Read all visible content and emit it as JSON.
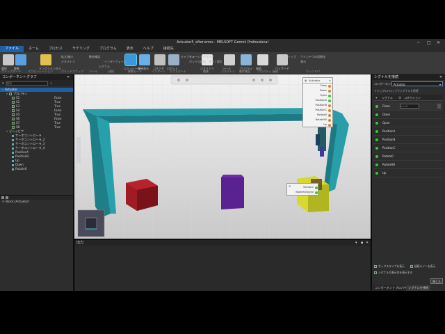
{
  "window": {
    "title": "Actuator5_after.emrx - MELSOFT Gemini Professional"
  },
  "menu": {
    "items": [
      "ファイル",
      "ホーム",
      "プロセス",
      "モデリング",
      "プログラム",
      "表示",
      "ヘルプ",
      "接続先"
    ],
    "active_index": 0
  },
  "ribbon": {
    "buttons": [
      {
        "label": "選択",
        "color": "#c8c8c8"
      },
      {
        "label": "移動",
        "color": "#5aa0e0"
      },
      {
        "label": "インクリメンタル",
        "color": "#e0c050"
      },
      {
        "label": "エミュレーター",
        "color": "#3a9ad9"
      },
      {
        "label": "接続表示",
        "color": "#6ab0e8"
      },
      {
        "label": "コネクタ",
        "color": "#c0c0c0"
      },
      {
        "label": "ロボット",
        "color": "#9ab0c8"
      },
      {
        "label": "ジオメトリ",
        "color": "#e6e6e6"
      },
      {
        "label": "ツール",
        "color": "#d0d0d0"
      },
      {
        "label": "プロパティ",
        "color": "#8ab4d8"
      },
      {
        "label": "接続",
        "color": "#d8d8d8"
      },
      {
        "label": "ウィザード",
        "color": "#c8c8c8"
      }
    ],
    "small": [
      "拡大/縮小",
      "ジオメトリ",
      "動作確認",
      "インターフェース",
      "シグナル",
      "キャプチャ",
      "ミュージックマルチ",
      "ボックス追加",
      "表示 / 隠れ",
      "ストップ",
      "ウインドウの初期化",
      "表示"
    ],
    "groups": [
      "クリップボード",
      "マニピュレーション",
      "グリッドスナップ",
      "ツール",
      "接続",
      "移動モード",
      "インポート",
      "エクスポート",
      "編集",
      "ジオメトリ",
      "動作確認",
      "プロパティ",
      "接続",
      "ウィンドウ"
    ]
  },
  "left_panel": {
    "title": "コンポーネントグラフ",
    "search_placeholder": "検索",
    "tree": [
      {
        "label": "Actuator",
        "value": "",
        "indent": 0,
        "selected": true,
        "check": false
      },
      {
        "label": "プロパティ",
        "value": "",
        "indent": 1,
        "selected": false,
        "check": true
      },
      {
        "label": "S1",
        "value": "False",
        "indent": 2,
        "selected": false,
        "check": true
      },
      {
        "label": "S2",
        "value": "True",
        "indent": 2,
        "selected": false,
        "check": true
      },
      {
        "label": "S3",
        "value": "True",
        "indent": 2,
        "selected": false,
        "check": true
      },
      {
        "label": "S4",
        "value": "False",
        "indent": 2,
        "selected": false,
        "check": true
      },
      {
        "label": "S5",
        "value": "True",
        "indent": 2,
        "selected": false,
        "check": true
      },
      {
        "label": "S6",
        "value": "False",
        "indent": 2,
        "selected": false,
        "check": true
      },
      {
        "label": "S7",
        "value": "True",
        "indent": 2,
        "selected": false,
        "check": true
      },
      {
        "label": "S8",
        "value": "True",
        "indent": 2,
        "selected": false,
        "check": true
      },
      {
        "label": "ビヘイビア",
        "value": "",
        "indent": 1,
        "selected": false,
        "check": false
      },
      {
        "label": "サーボコントローラ",
        "value": "",
        "indent": 2,
        "selected": false,
        "check": false
      },
      {
        "label": "サーボコントローラ_2",
        "value": "",
        "indent": 2,
        "selected": false,
        "check": false
      },
      {
        "label": "サーボコントローラ_3",
        "value": "",
        "indent": 2,
        "selected": false,
        "check": false
      },
      {
        "label": "サーボコントローラ_4",
        "value": "",
        "indent": 2,
        "selected": false,
        "check": false
      },
      {
        "label": "PositionA",
        "value": "",
        "indent": 2,
        "selected": false,
        "check": false
      },
      {
        "label": "PositionB",
        "value": "",
        "indent": 2,
        "selected": false,
        "check": false
      },
      {
        "label": "Up",
        "value": "",
        "indent": 2,
        "selected": false,
        "check": false
      },
      {
        "label": "Down",
        "value": "",
        "indent": 2,
        "selected": false,
        "check": false
      },
      {
        "label": "Rotate0",
        "value": "",
        "indent": 2,
        "selected": false,
        "check": false
      }
    ],
    "lower_item": "Block [Actuator]"
  },
  "viewport": {
    "signal_box_title": "Actuator",
    "signal_box_items": [
      "Close",
      "Down",
      "Open",
      "PositionA",
      "PositionB",
      "PositionC",
      "Rotate0",
      "Rotate90",
      "Up"
    ],
    "sensor_box_items": [
      "SensorC",
      "BooleanSignal"
    ],
    "nav_cube": {
      "top": "T",
      "left": "L",
      "right": "R",
      "bottom": "B"
    }
  },
  "output_panel": {
    "title": "出力"
  },
  "right_panel": {
    "title": "シグナルを接続",
    "component_label": "コンポーネント",
    "component_value": "Actuator",
    "hint": "ドラッグ&ドロップでシグナルを接続",
    "col_signal": "シグナル",
    "col_connection": "コネクション",
    "input_placeholder": "Input1",
    "signals": [
      "Close",
      "Down",
      "Open",
      "PositionA",
      "PositionB",
      "PositionC",
      "Rotate0",
      "Rotate90",
      "Up"
    ],
    "opt1": "ボックスタイプを表示",
    "opt2": "接続ラインを表示",
    "opt3": "シグナルの表示名を表示する",
    "close_btn": "閉じる"
  },
  "bottom_tabs": [
    "コンポーネントプロパティ",
    "シグナルを接続"
  ]
}
